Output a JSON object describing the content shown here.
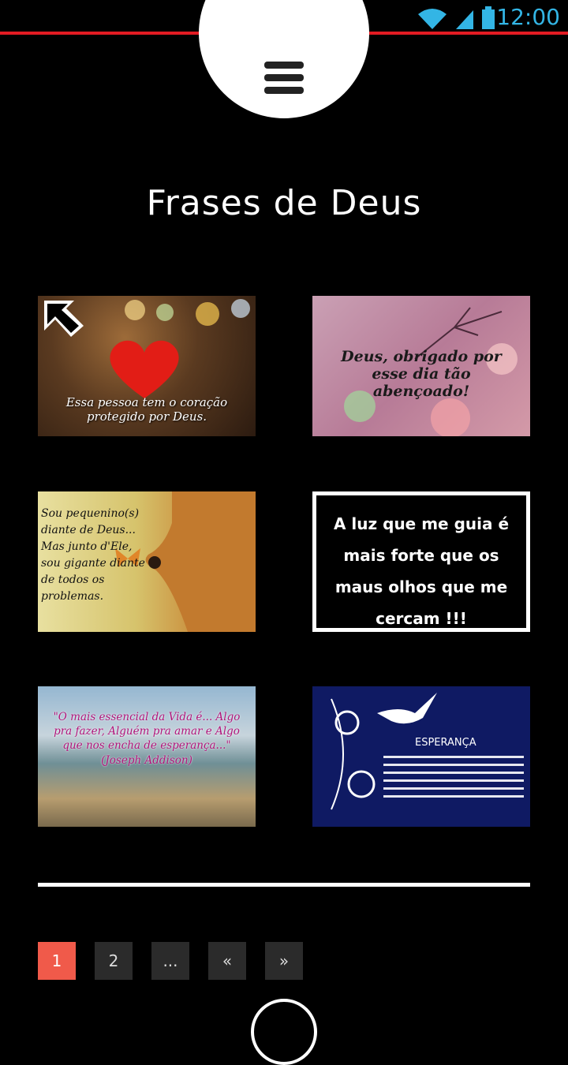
{
  "status": {
    "time": "12:00"
  },
  "header": {
    "title": "Frases de Deus"
  },
  "tiles": [
    {
      "caption": "Essa pessoa tem o coração protegido por Deus."
    },
    {
      "caption": "Deus, obrigado por esse dia tão abençoado!"
    },
    {
      "caption": "Sou pequenino(s) diante de Deus... Mas junto d'Ele, sou gigante diante de todos os problemas."
    },
    {
      "caption": "A luz que me guia é mais forte que os maus olhos que me cercam !!!"
    },
    {
      "caption": "\"O mais essencial da Vida é... Algo pra fazer, Alguém pra amar e Algo que nos encha de esperança...\" (Joseph Addison)"
    },
    {
      "title": "ESPERANÇA"
    }
  ],
  "pagination": {
    "items": [
      "1",
      "2",
      "...",
      "«",
      "»"
    ],
    "active": "1"
  },
  "colors": {
    "accent": "#f05a4a",
    "status_line": "#e31b23",
    "status_text": "#33b5e5"
  }
}
